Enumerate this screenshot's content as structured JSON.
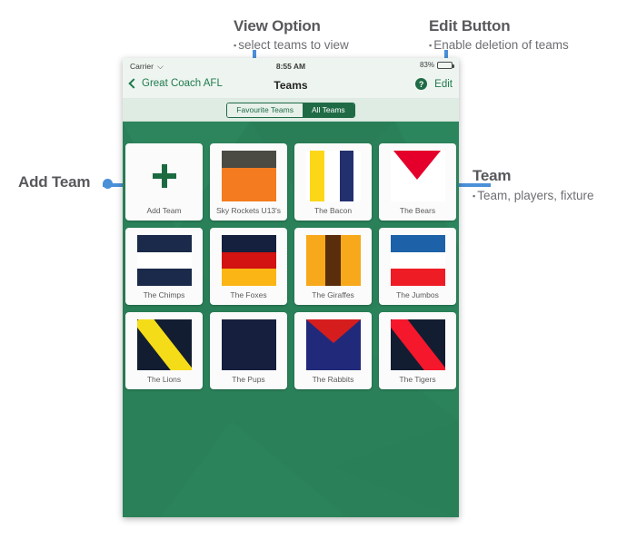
{
  "annotations": [
    {
      "id": "view-option",
      "title": "View Option",
      "sub": "select teams to view"
    },
    {
      "id": "edit-button",
      "title": "Edit Button",
      "sub": "Enable deletion of teams"
    },
    {
      "id": "add-team",
      "title": "Add Team",
      "sub": ""
    },
    {
      "id": "team",
      "title": "Team",
      "sub": "Team, players, fixture"
    }
  ],
  "status_bar": {
    "carrier": "Carrier",
    "wifi_icon": "wifi-icon",
    "time": "8:55 AM",
    "battery_percent": "83%"
  },
  "nav_bar": {
    "back_label": "Great Coach AFL",
    "title": "Teams",
    "help_label": "?",
    "edit_label": "Edit"
  },
  "segmented_control": {
    "options": [
      {
        "label": "Favourite Teams",
        "selected": false
      },
      {
        "label": "All Teams",
        "selected": true
      }
    ]
  },
  "teams": [
    {
      "name": "Add Team",
      "art": "add"
    },
    {
      "name": "Sky Rockets U13's",
      "art": "halves-h",
      "colors": [
        "#4b4b44",
        "#f47b20"
      ]
    },
    {
      "name": "The Bacon",
      "art": "bars-v-2",
      "colors": [
        "#fbd718",
        "#23306e"
      ]
    },
    {
      "name": "The Bears",
      "art": "triangle-down",
      "colors": [
        "#ffffff",
        "#e4002b"
      ]
    },
    {
      "name": "The Chimps",
      "art": "bands-h-3",
      "colors": [
        "#1b2a4a",
        "#ffffff",
        "#1b2a4a"
      ]
    },
    {
      "name": "The Foxes",
      "art": "bands-h-3",
      "colors": [
        "#14203d",
        "#d31212",
        "#fbb615"
      ]
    },
    {
      "name": "The Giraffes",
      "art": "stripe-v-center",
      "colors": [
        "#f7a81b",
        "#5a2d0c"
      ]
    },
    {
      "name": "The Jumbos",
      "art": "bands-h-3",
      "colors": [
        "#1d62a8",
        "#ffffff",
        "#ee1c25"
      ]
    },
    {
      "name": "The Lions",
      "art": "sash",
      "colors": [
        "#131d31",
        "#f5dc18"
      ]
    },
    {
      "name": "The Pups",
      "art": "solid",
      "colors": [
        "#161f3d"
      ]
    },
    {
      "name": "The Rabbits",
      "art": "triangle-down-full",
      "colors": [
        "#212a7a",
        "#d61d1d"
      ]
    },
    {
      "name": "The Tigers",
      "art": "sash",
      "colors": [
        "#131d31",
        "#f5172b"
      ]
    }
  ],
  "colors": {
    "app_green": "#2a8059",
    "nav_tint": "#1f7a4d",
    "annotation_text": "#58595b",
    "connector_blue": "#4a90d9"
  }
}
